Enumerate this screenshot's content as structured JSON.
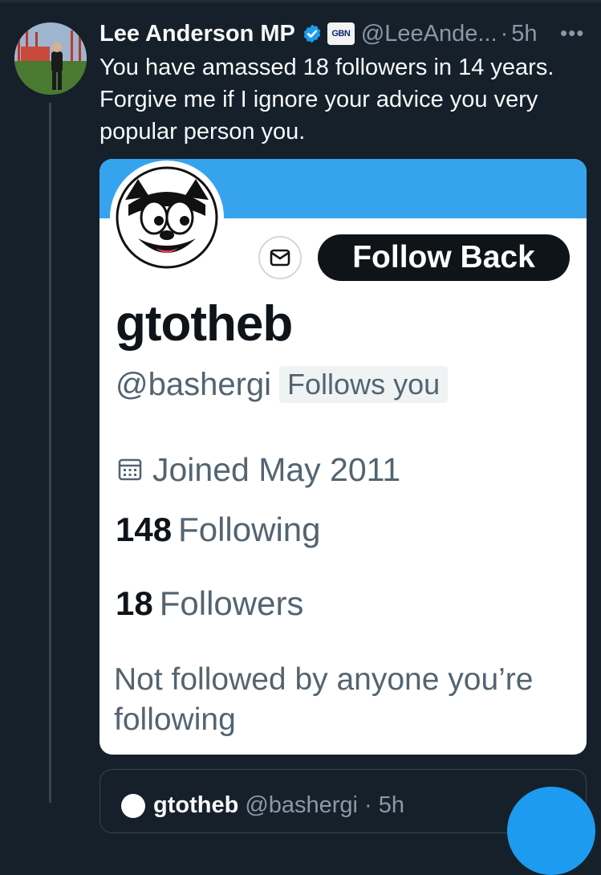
{
  "tweet": {
    "author_name": "Lee Anderson MP",
    "affiliation_badge": "GBN",
    "handle": "@LeeAnde...",
    "separator": "·",
    "time": "5h",
    "more_label": "•••",
    "text": "You have amassed 18 followers in 14 years. Forgive me if I ignore your advice you very popular person you."
  },
  "profile_card": {
    "follow_button": "Follow Back",
    "display_name": "gtotheb",
    "username": "@bashergi",
    "follows_you": "Follows you",
    "joined": "Joined May 2011",
    "following_count": "148",
    "following_label": "Following",
    "followers_count": "18",
    "followers_label": "Followers",
    "mutuals_text": "Not followed by anyone you’re following"
  },
  "quoted_tweet": {
    "name": "gtotheb",
    "handle": "@bashergi · 5h"
  },
  "colors": {
    "background": "#15202b",
    "accent": "#1d9bf0",
    "banner": "#36a3ef",
    "secondary_text": "#8b98a5"
  },
  "icons": [
    "verified-badge-icon",
    "more-options-icon",
    "envelope-icon",
    "calendar-icon"
  ]
}
